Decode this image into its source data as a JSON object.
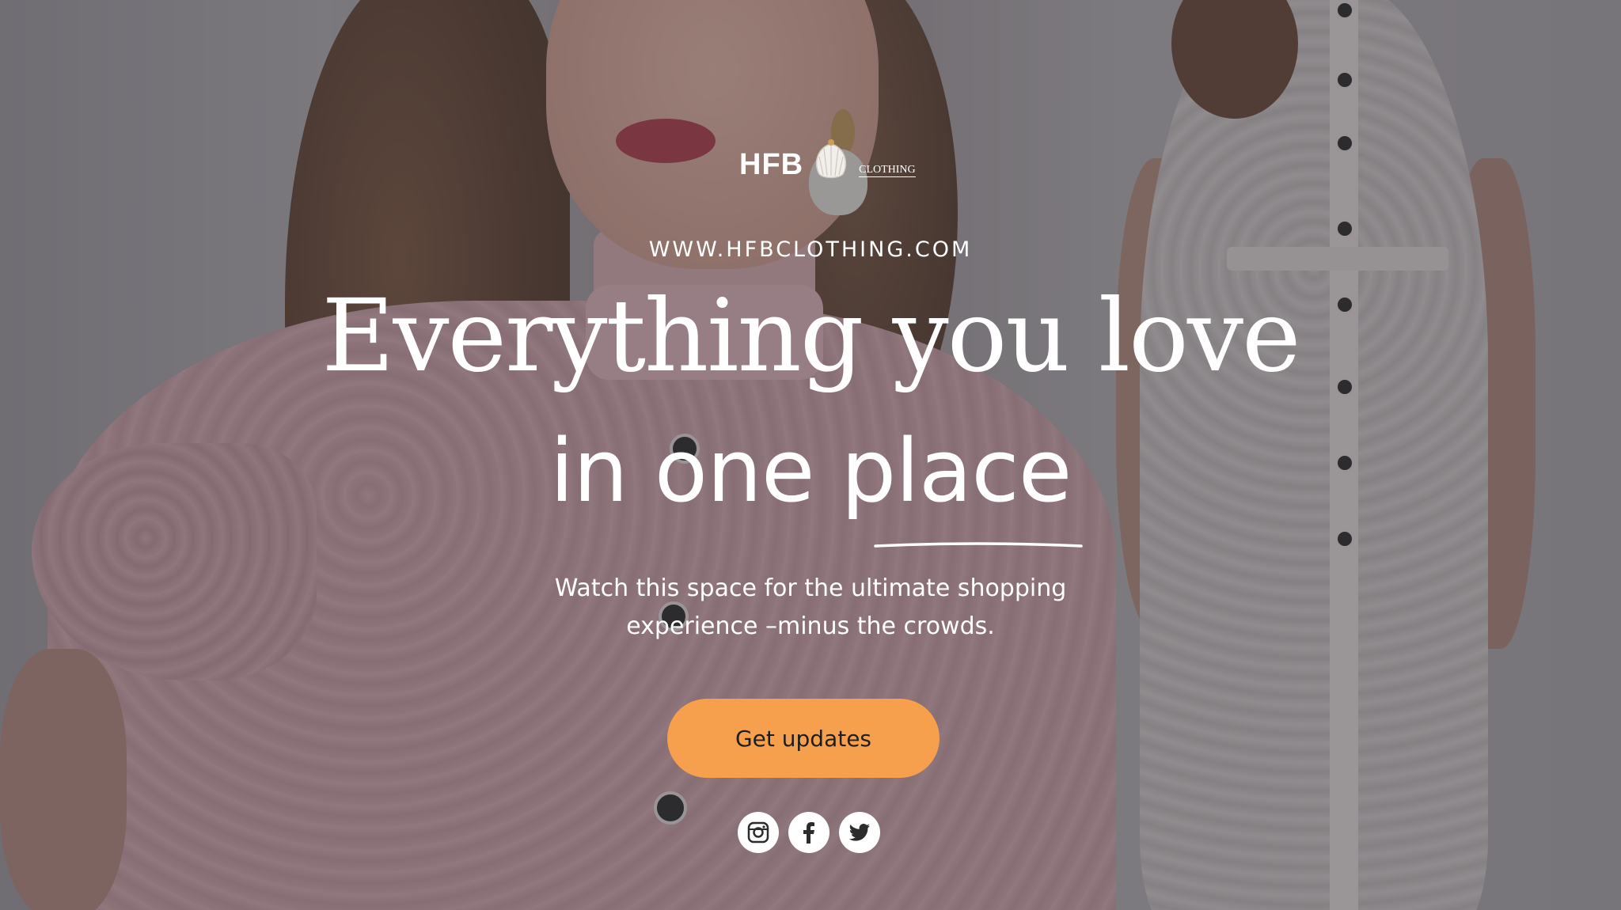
{
  "brand": {
    "logo_mark": "HFB",
    "logo_tagline": "CLOTHING",
    "site_url": "WWW.HFBCLOTHING.COM"
  },
  "hero": {
    "headline_line1": "Everything you love",
    "headline_line2": "in one place",
    "subtitle_line1": "Watch this space for the ultimate shopping",
    "subtitle_line2": "experience –minus the crowds."
  },
  "cta": {
    "label": "Get updates",
    "color": "#f6a04d"
  },
  "socials": [
    {
      "icon": "instagram-icon"
    },
    {
      "icon": "facebook-icon"
    },
    {
      "icon": "twitter-icon"
    }
  ]
}
